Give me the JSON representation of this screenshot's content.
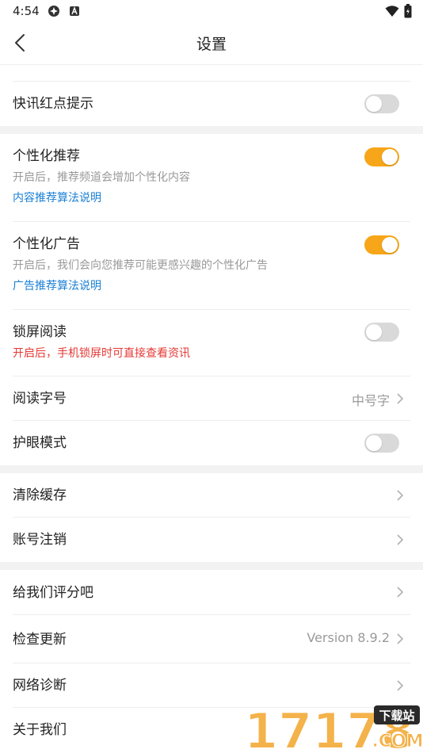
{
  "status": {
    "time": "4:54"
  },
  "header": {
    "title": "设置"
  },
  "settings": {
    "kuaixun": {
      "title": "快讯红点提示",
      "enabled": false
    },
    "personal_recommend": {
      "title": "个性化推荐",
      "desc": "开启后，推荐频道会增加个性化内容",
      "link": "内容推荐算法说明",
      "enabled": true
    },
    "personal_ads": {
      "title": "个性化广告",
      "desc": "开启后，我们会向您推荐可能更感兴趣的个性化广告",
      "link": "广告推荐算法说明",
      "enabled": true
    },
    "lockscreen": {
      "title": "锁屏阅读",
      "desc": "开启后，手机锁屏时可直接查看资讯",
      "enabled": false
    },
    "font_size": {
      "title": "阅读字号",
      "value": "中号字"
    },
    "eye_care": {
      "title": "护眼模式",
      "enabled": false
    },
    "clear_cache": {
      "title": "清除缓存"
    },
    "delete_account": {
      "title": "账号注销"
    },
    "rate": {
      "title": "给我们评分吧"
    },
    "update": {
      "title": "检查更新",
      "value": "Version 8.9.2"
    },
    "network": {
      "title": "网络诊断"
    },
    "about": {
      "title": "关于我们"
    }
  },
  "watermark": {
    "text": "17178",
    "badge": "下载站",
    "sub": ".COM"
  },
  "colors": {
    "accent": "#f7a619",
    "link": "#1a7fd4",
    "warn": "#e53935"
  }
}
